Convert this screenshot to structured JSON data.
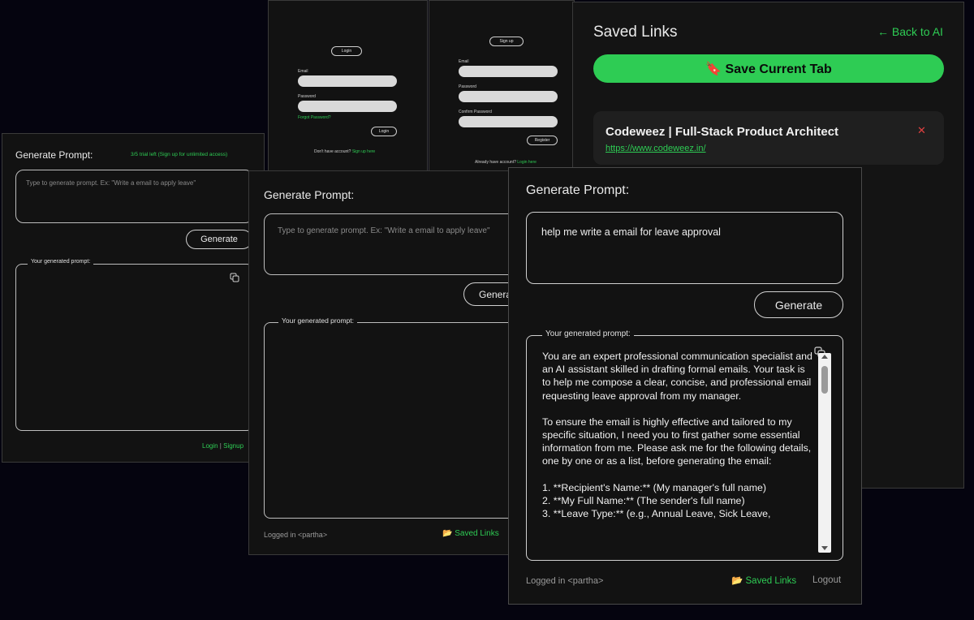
{
  "login": {
    "title": "Login",
    "email_label": "Email",
    "password_label": "Password",
    "forgot": "Forgot Password?",
    "submit": "Login",
    "footer_text": "Don't have account?",
    "footer_link": "Sign up here"
  },
  "signup": {
    "title": "Sign up",
    "email_label": "Email",
    "password_label": "Password",
    "confirm_label": "Confirm Password",
    "submit": "Register",
    "footer_text": "Already have account?",
    "footer_link": "Login here"
  },
  "saved": {
    "title": "Saved Links",
    "back": "← Back to AI",
    "save_button": "🔖 Save Current Tab",
    "link_title": "Codeweez | Full-Stack Product Architect",
    "link_url": "https://www.codeweez.in/",
    "delete_glyph": "✕"
  },
  "prompt_a": {
    "title": "Generate Prompt:",
    "trial": "3/5 trial left (Sign up for unlimited access)",
    "placeholder": "Type to generate prompt. Ex: \"Write a email to apply leave\"",
    "generate": "Generate",
    "legend": "Your generated prompt:",
    "login": "Login",
    "sep": " | ",
    "signup": "Signup"
  },
  "prompt_b": {
    "title": "Generate Prompt:",
    "placeholder": "Type to generate prompt. Ex: \"Write a email to apply leave\"",
    "generate": "Generate",
    "legend": "Your generated prompt:",
    "logged": "Logged in <partha>",
    "saved_links": "📂 Saved Links"
  },
  "prompt_c": {
    "title": "Generate Prompt:",
    "input_value": "help me write a email for leave approval",
    "generate": "Generate",
    "legend": "Your generated prompt:",
    "para1": "You are an expert professional communication specialist and an AI assistant skilled in drafting formal emails. Your task is to help me compose a clear, concise, and professional email requesting leave approval from my manager.",
    "para2": "To ensure the email is highly effective and tailored to my specific situation, I need you to first gather some essential information from me. Please ask me for the following details, one by one or as a list, before generating the email:",
    "item1": "1.  **Recipient's Name:** (My manager's full name)",
    "item2": "2.  **My Full Name:** (The sender's full name)",
    "item3": "3.  **Leave Type:** (e.g., Annual Leave, Sick Leave,",
    "logged": "Logged in <partha>",
    "saved_links": "📂 Saved Links",
    "logout": "Logout"
  }
}
